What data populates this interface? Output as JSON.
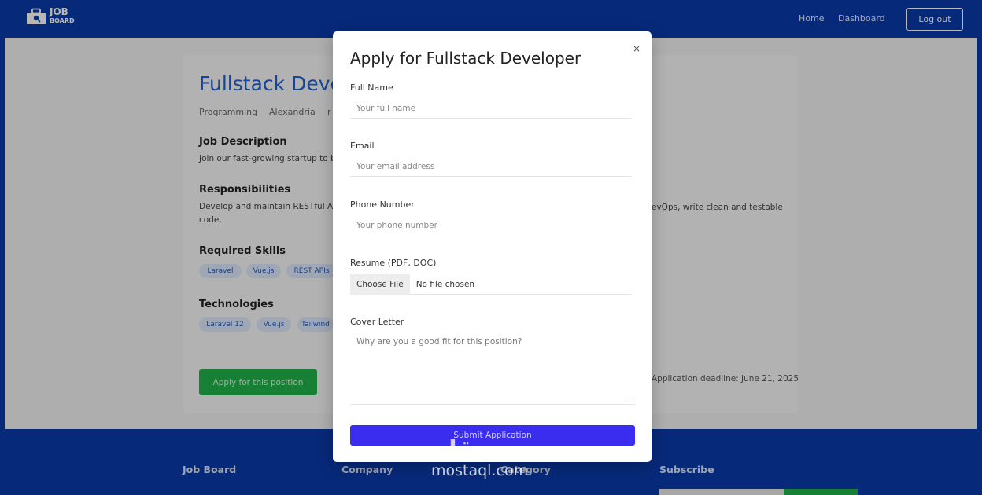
{
  "nav": {
    "logo_main": "JOB",
    "logo_sub": "BOARD",
    "home": "Home",
    "dashboard": "Dashboard",
    "logout": "Log out"
  },
  "job": {
    "title": "Fullstack Deve",
    "category": "Programming",
    "location": "Alexandria",
    "extra": "r",
    "description_heading": "Job Description",
    "description_text": "Join our fast-growing startup to bu",
    "responsibilities_heading": "Responsibilities",
    "responsibilities_text_1": "Develop and maintain RESTful APIs",
    "responsibilities_text_2": "code.",
    "responsibilities_tail": "evOps, write clean and testable",
    "skills_heading": "Required Skills",
    "skills": [
      "Laravel",
      "Vue.js",
      "REST APIs"
    ],
    "tech_heading": "Technologies",
    "technologies": [
      "Laravel 12",
      "Vue.js",
      "Tailwind"
    ],
    "apply_label": "Apply for this position",
    "deadline": "Application deadline: June 21, 2025"
  },
  "modal": {
    "title": "Apply for Fullstack Developer",
    "close": "×",
    "full_name_label": "Full Name",
    "full_name_placeholder": "Your full name",
    "email_label": "Email",
    "email_placeholder": "Your email address",
    "phone_label": "Phone Number",
    "phone_placeholder": "Your phone number",
    "resume_label": "Resume (PDF, DOC)",
    "file_button": "Choose File",
    "file_status": "No file chosen",
    "cover_label": "Cover Letter",
    "cover_placeholder": "Why are you a good fit for this position?",
    "submit": "Submit Application"
  },
  "footer": {
    "col1": "Job Board",
    "col2": "Company",
    "col3": "Category",
    "col4": "Subscribe"
  },
  "watermark": {
    "arabic": "مستقل",
    "latin": "mostaql.com"
  },
  "colors": {
    "brand_blue": "#0a3aa8",
    "accent_green": "#21b24a",
    "submit_purple": "#3b2df0",
    "title_blue": "#1f5fd0"
  }
}
